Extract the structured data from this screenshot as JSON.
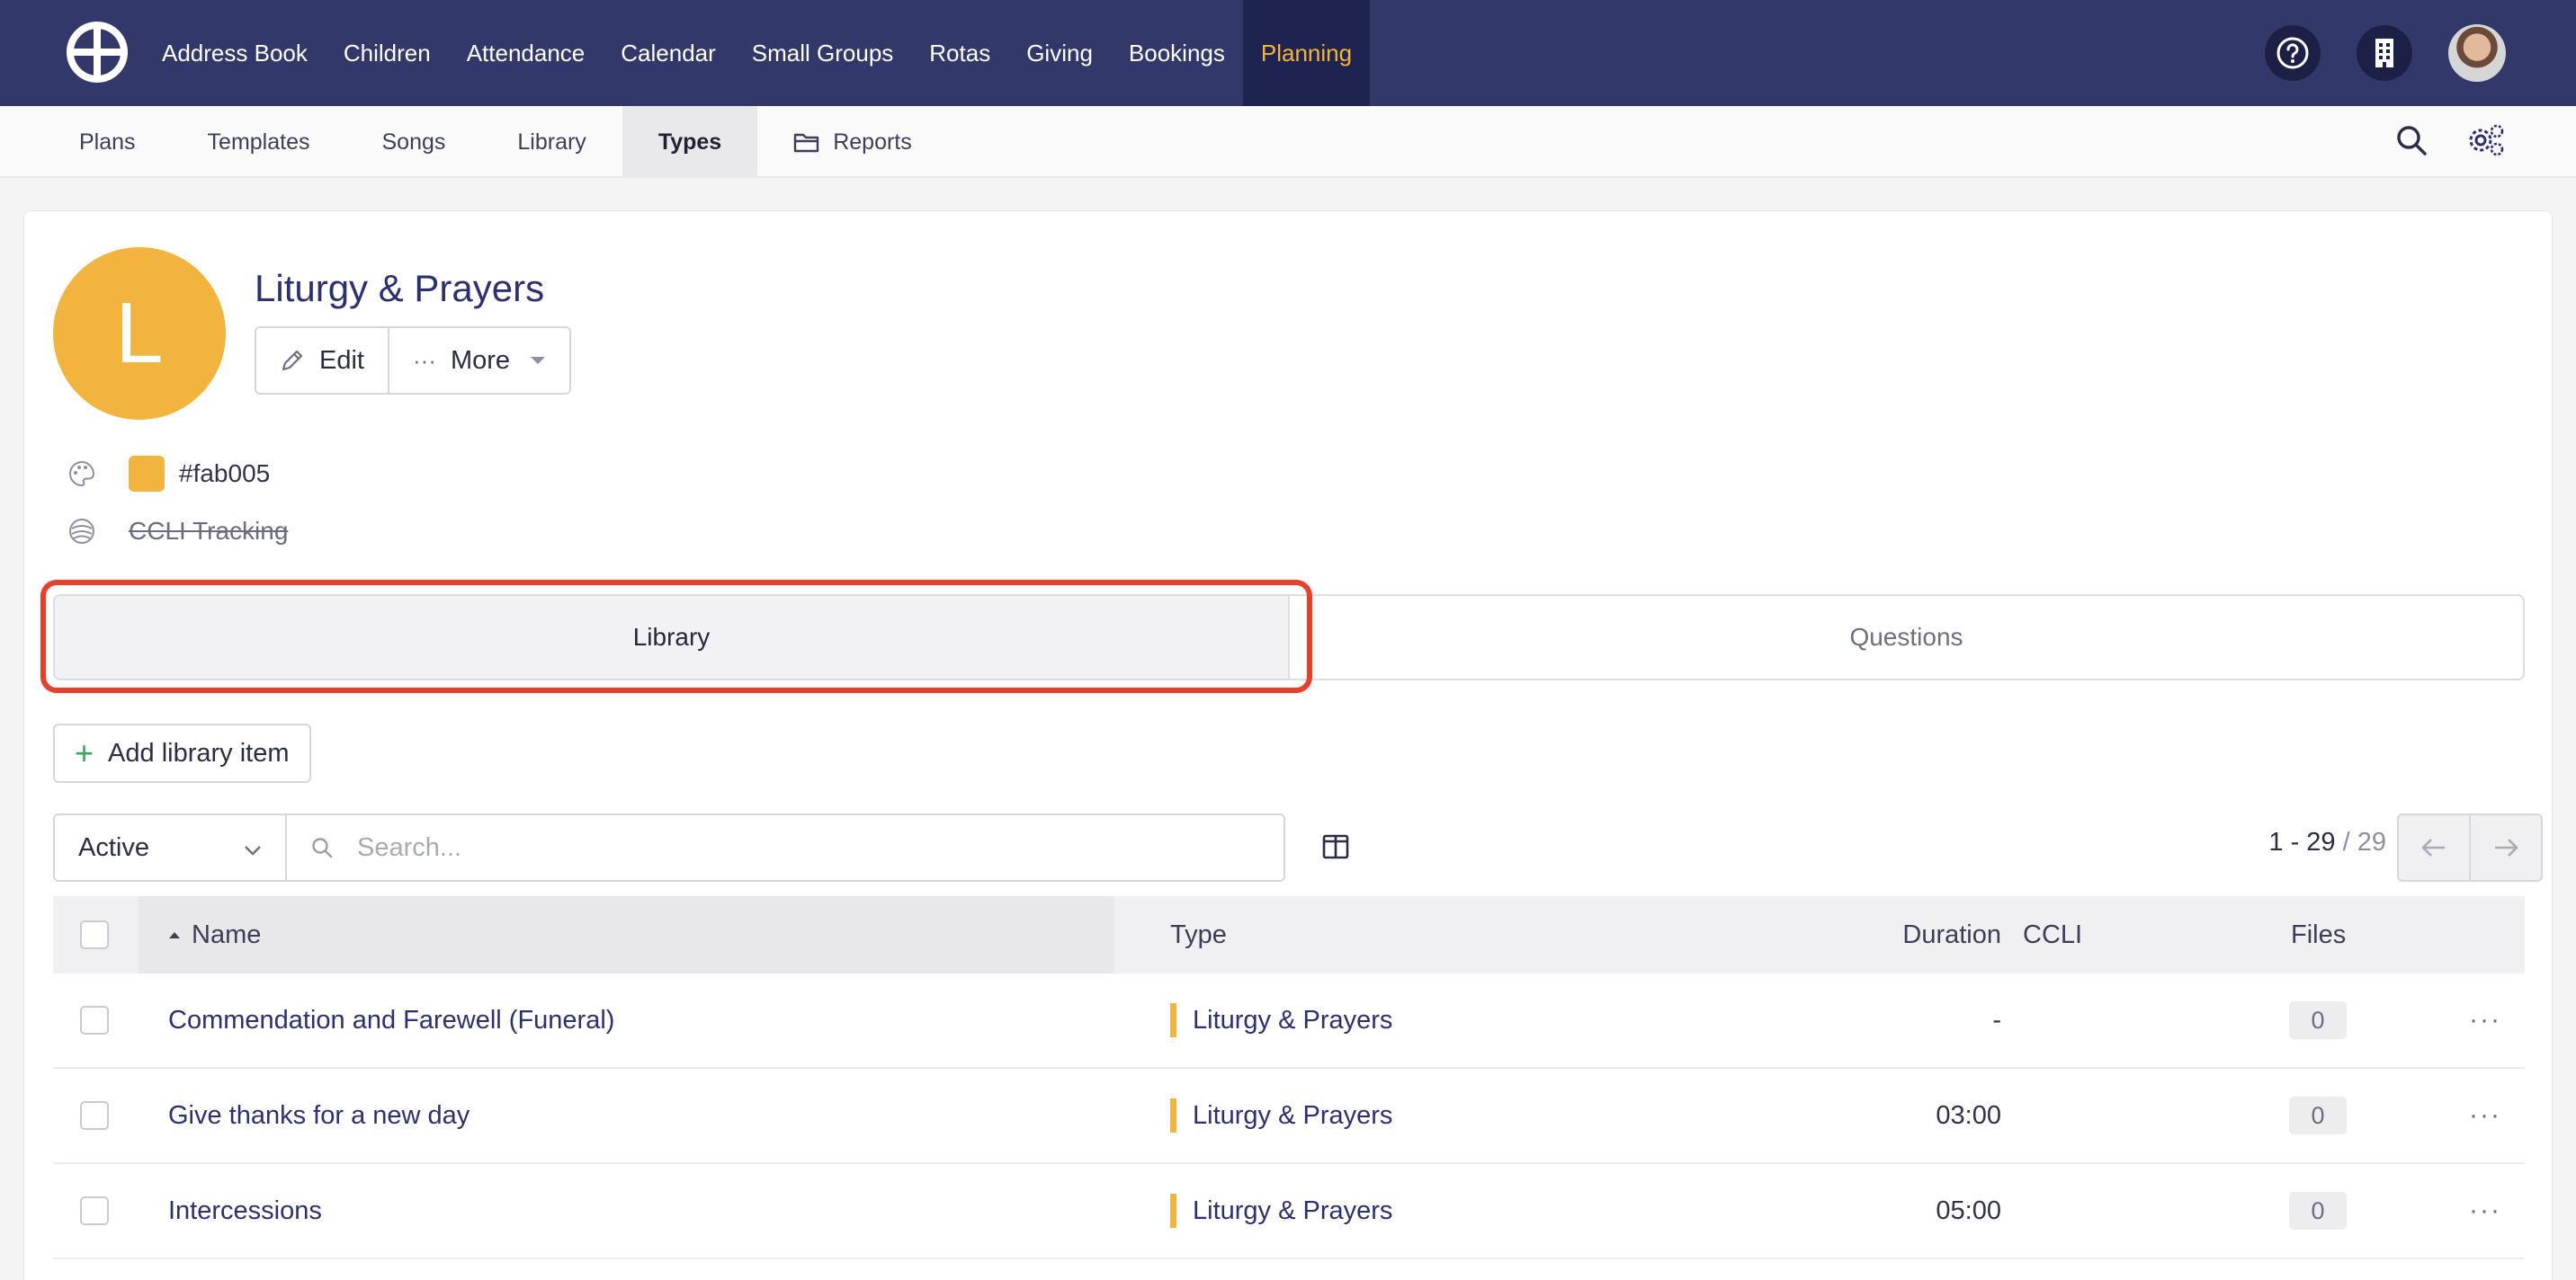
{
  "topnav": {
    "items": [
      "Address Book",
      "Children",
      "Attendance",
      "Calendar",
      "Small Groups",
      "Rotas",
      "Giving",
      "Bookings",
      "Planning"
    ],
    "active": "Planning",
    "icons": [
      "help-icon",
      "building-icon",
      "user-avatar"
    ]
  },
  "subnav": {
    "items": [
      "Plans",
      "Templates",
      "Songs",
      "Library",
      "Types",
      "Reports"
    ],
    "active": "Types"
  },
  "type": {
    "initial": "L",
    "title": "Liturgy & Prayers",
    "edit_label": "Edit",
    "more_label": "More",
    "color_hex": "#fab005",
    "ccli_label": "CCLI Tracking",
    "avatar_color": "#f0b43f"
  },
  "tabs": [
    {
      "label": "Library",
      "active": true
    },
    {
      "label": "Questions",
      "active": false
    }
  ],
  "add_button_label": "Add library item",
  "filter": {
    "status_value": "Active",
    "search_placeholder": "Search..."
  },
  "pagination": {
    "range": "1 - 29",
    "total": "/ 29"
  },
  "table": {
    "columns": {
      "name": "Name",
      "type": "Type",
      "duration": "Duration",
      "ccli": "CCLI",
      "files": "Files"
    },
    "rows": [
      {
        "name": "Commendation and Farewell (Funeral)",
        "type": "Liturgy & Prayers",
        "duration": "-",
        "ccli": "",
        "files": "0"
      },
      {
        "name": "Give thanks for a new day",
        "type": "Liturgy & Prayers",
        "duration": "03:00",
        "ccli": "",
        "files": "0"
      },
      {
        "name": "Intercessions",
        "type": "Liturgy & Prayers",
        "duration": "05:00",
        "ccli": "",
        "files": "0"
      }
    ]
  },
  "colors": {
    "nav_bg": "#33386a",
    "nav_active_text": "#f3b43a",
    "highlight": "#e8402a"
  }
}
